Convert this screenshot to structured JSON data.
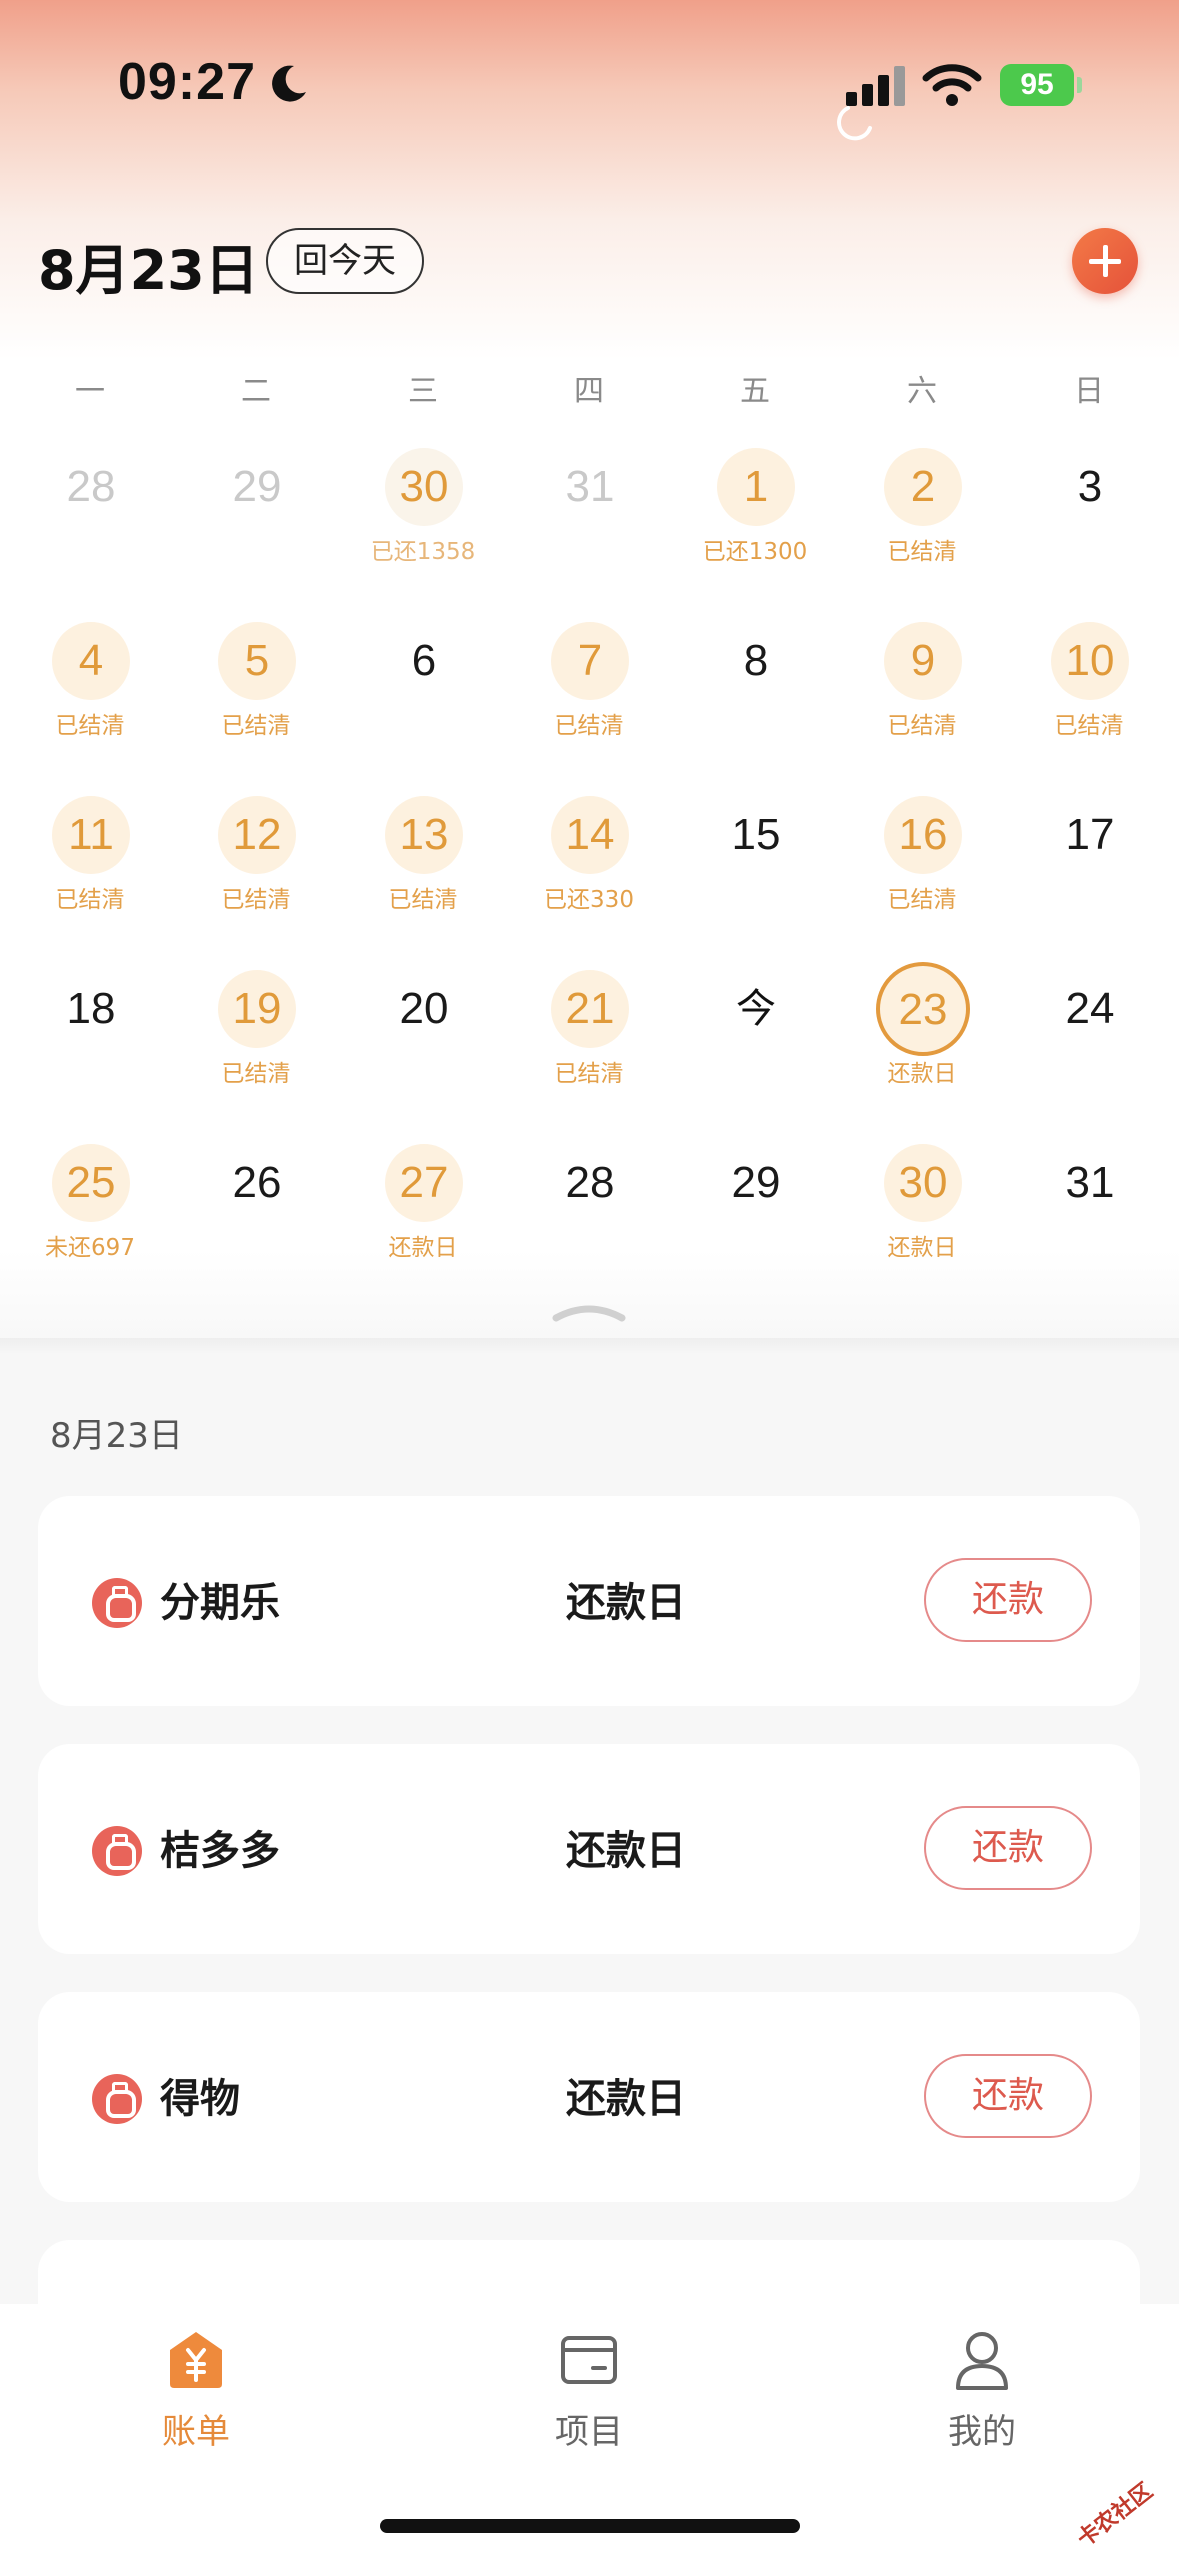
{
  "status_bar": {
    "time": "09:27",
    "battery": "95"
  },
  "header": {
    "date": "8月23日",
    "today_button": "回今天"
  },
  "weekdays": [
    "一",
    "二",
    "三",
    "四",
    "五",
    "六",
    "日"
  ],
  "calendar": [
    [
      {
        "day": "28",
        "style": "muted",
        "note": ""
      },
      {
        "day": "29",
        "style": "muted",
        "note": ""
      },
      {
        "day": "30",
        "style": "muted-hl",
        "note": "已还1358"
      },
      {
        "day": "31",
        "style": "muted",
        "note": ""
      },
      {
        "day": "1",
        "style": "hl",
        "note": "已还1300"
      },
      {
        "day": "2",
        "style": "hl",
        "note": "已结清"
      },
      {
        "day": "3",
        "style": "plain",
        "note": ""
      }
    ],
    [
      {
        "day": "4",
        "style": "hl",
        "note": "已结清"
      },
      {
        "day": "5",
        "style": "hl",
        "note": "已结清"
      },
      {
        "day": "6",
        "style": "plain",
        "note": ""
      },
      {
        "day": "7",
        "style": "hl",
        "note": "已结清"
      },
      {
        "day": "8",
        "style": "plain",
        "note": ""
      },
      {
        "day": "9",
        "style": "hl",
        "note": "已结清"
      },
      {
        "day": "10",
        "style": "hl",
        "note": "已结清"
      }
    ],
    [
      {
        "day": "11",
        "style": "hl",
        "note": "已结清"
      },
      {
        "day": "12",
        "style": "hl",
        "note": "已结清"
      },
      {
        "day": "13",
        "style": "hl",
        "note": "已结清"
      },
      {
        "day": "14",
        "style": "hl",
        "note": "已还330"
      },
      {
        "day": "15",
        "style": "plain",
        "note": ""
      },
      {
        "day": "16",
        "style": "hl",
        "note": "已结清"
      },
      {
        "day": "17",
        "style": "plain",
        "note": ""
      }
    ],
    [
      {
        "day": "18",
        "style": "plain",
        "note": ""
      },
      {
        "day": "19",
        "style": "hl",
        "note": "已结清"
      },
      {
        "day": "20",
        "style": "plain",
        "note": ""
      },
      {
        "day": "21",
        "style": "hl",
        "note": "已结清"
      },
      {
        "day": "今",
        "style": "today",
        "note": ""
      },
      {
        "day": "23",
        "style": "selected",
        "note": "还款日"
      },
      {
        "day": "24",
        "style": "plain",
        "note": ""
      }
    ],
    [
      {
        "day": "25",
        "style": "hl",
        "note": "未还697"
      },
      {
        "day": "26",
        "style": "plain",
        "note": ""
      },
      {
        "day": "27",
        "style": "hl",
        "note": "还款日"
      },
      {
        "day": "28",
        "style": "plain",
        "note": ""
      },
      {
        "day": "29",
        "style": "plain",
        "note": ""
      },
      {
        "day": "30",
        "style": "hl",
        "note": "还款日"
      },
      {
        "day": "31",
        "style": "plain",
        "note": ""
      }
    ]
  ],
  "list": {
    "date": "8月23日",
    "items": [
      {
        "name": "分期乐",
        "status": "还款日",
        "button": "还款"
      },
      {
        "name": "桔多多",
        "status": "还款日",
        "button": "还款"
      },
      {
        "name": "得物",
        "status": "还款日",
        "button": "还款"
      }
    ]
  },
  "tabbar": {
    "tabs": [
      {
        "label": "账单",
        "icon": "bill-home-icon",
        "active": true
      },
      {
        "label": "项目",
        "icon": "wallet-icon",
        "active": false
      },
      {
        "label": "我的",
        "icon": "person-icon",
        "active": false
      }
    ]
  },
  "watermark": "卡农社区",
  "colors": {
    "accent": "#e39a3e",
    "repay": "#dd5a4e",
    "add": "#e5523a"
  }
}
